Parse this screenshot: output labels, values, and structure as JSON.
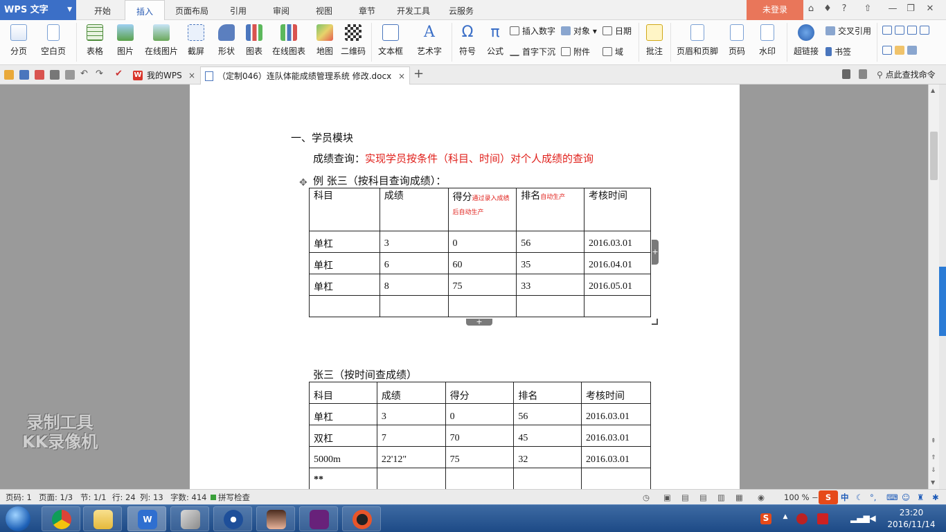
{
  "titlebar": {
    "app_menu": "WPS 文字",
    "tabs": [
      "开始",
      "插入",
      "页面布局",
      "引用",
      "审阅",
      "视图",
      "章节",
      "开发工具",
      "云服务"
    ],
    "active_tab": "插入",
    "login": "未登录",
    "help": "?"
  },
  "ribbon": {
    "page_break": "分页",
    "blank_page": "空白页",
    "table": "表格",
    "picture": "图片",
    "online_picture": "在线图片",
    "screenshot": "截屏",
    "shape": "形状",
    "chart": "图表",
    "online_chart": "在线图表",
    "map": "地图",
    "qrcode": "二维码",
    "textbox": "文本框",
    "wordart": "艺术字",
    "symbol": "符号",
    "formula": "公式",
    "insert_number": "插入数字",
    "object": "对象",
    "date": "日期",
    "dropcap": "首字下沉",
    "attachment": "附件",
    "field": "域",
    "comment": "批注",
    "header_footer": "页眉和页脚",
    "page_number": "页码",
    "watermark": "水印",
    "hyperlink": "超链接",
    "cross_ref": "交叉引用",
    "bookmark": "书签"
  },
  "tabbar": {
    "my_wps": "我的WPS",
    "doc_title": "（定制046）连队体能成绩管理系统 修改.docx",
    "close": "×",
    "new_tab": "+",
    "search_command": "点此查找命令"
  },
  "document": {
    "section_title": "一、学员模块",
    "query_label": "成绩查询：",
    "query_desc": "实现学员按条件（科目、时间）对个人成绩的查询",
    "example1": "例   张三（按科目查询成绩）：",
    "table1": {
      "headers": [
        "科目",
        "成绩",
        "得分",
        "排名",
        "考核时间"
      ],
      "score_note": "通过录入成绩后自动生产",
      "rank_note": "自动生产",
      "rows": [
        [
          "单杠",
          "3",
          "0",
          "56",
          "2016.03.01"
        ],
        [
          "单杠",
          "6",
          "60",
          "35",
          "2016.04.01"
        ],
        [
          "单杠",
          "8",
          "75",
          "33",
          "2016.05.01"
        ],
        [
          "",
          "",
          "",
          "",
          ""
        ]
      ]
    },
    "example2": "张三（按时间查成绩）",
    "table2": {
      "headers": [
        "科目",
        "成绩",
        "得分",
        "排名",
        "考核时间"
      ],
      "rows": [
        [
          "单杠",
          "3",
          "0",
          "56",
          "2016.03.01"
        ],
        [
          "双杠",
          "7",
          "70",
          "45",
          "2016.03.01"
        ],
        [
          "5000m",
          "22'12\"",
          "75",
          "32",
          "2016.03.01"
        ],
        [
          "**",
          "",
          "",
          "",
          ""
        ]
      ]
    }
  },
  "watermark": {
    "line1": "录制工具",
    "line2": "KK录像机"
  },
  "statusbar": {
    "page_code": "页码: 1",
    "page": "页面: 1/3",
    "section": "节: 1/1",
    "row": "行: 24",
    "col": "列: 13",
    "words": "字数: 414",
    "spellcheck": "拼写检查",
    "zoom": "100 %"
  },
  "taskbar": {
    "clock_time": "23:20",
    "clock_date": "2016/11/14",
    "ime": "中"
  },
  "colors": {
    "accent": "#3b6fc7",
    "login_bg": "#e9765a",
    "red_text": "#e0201b"
  }
}
